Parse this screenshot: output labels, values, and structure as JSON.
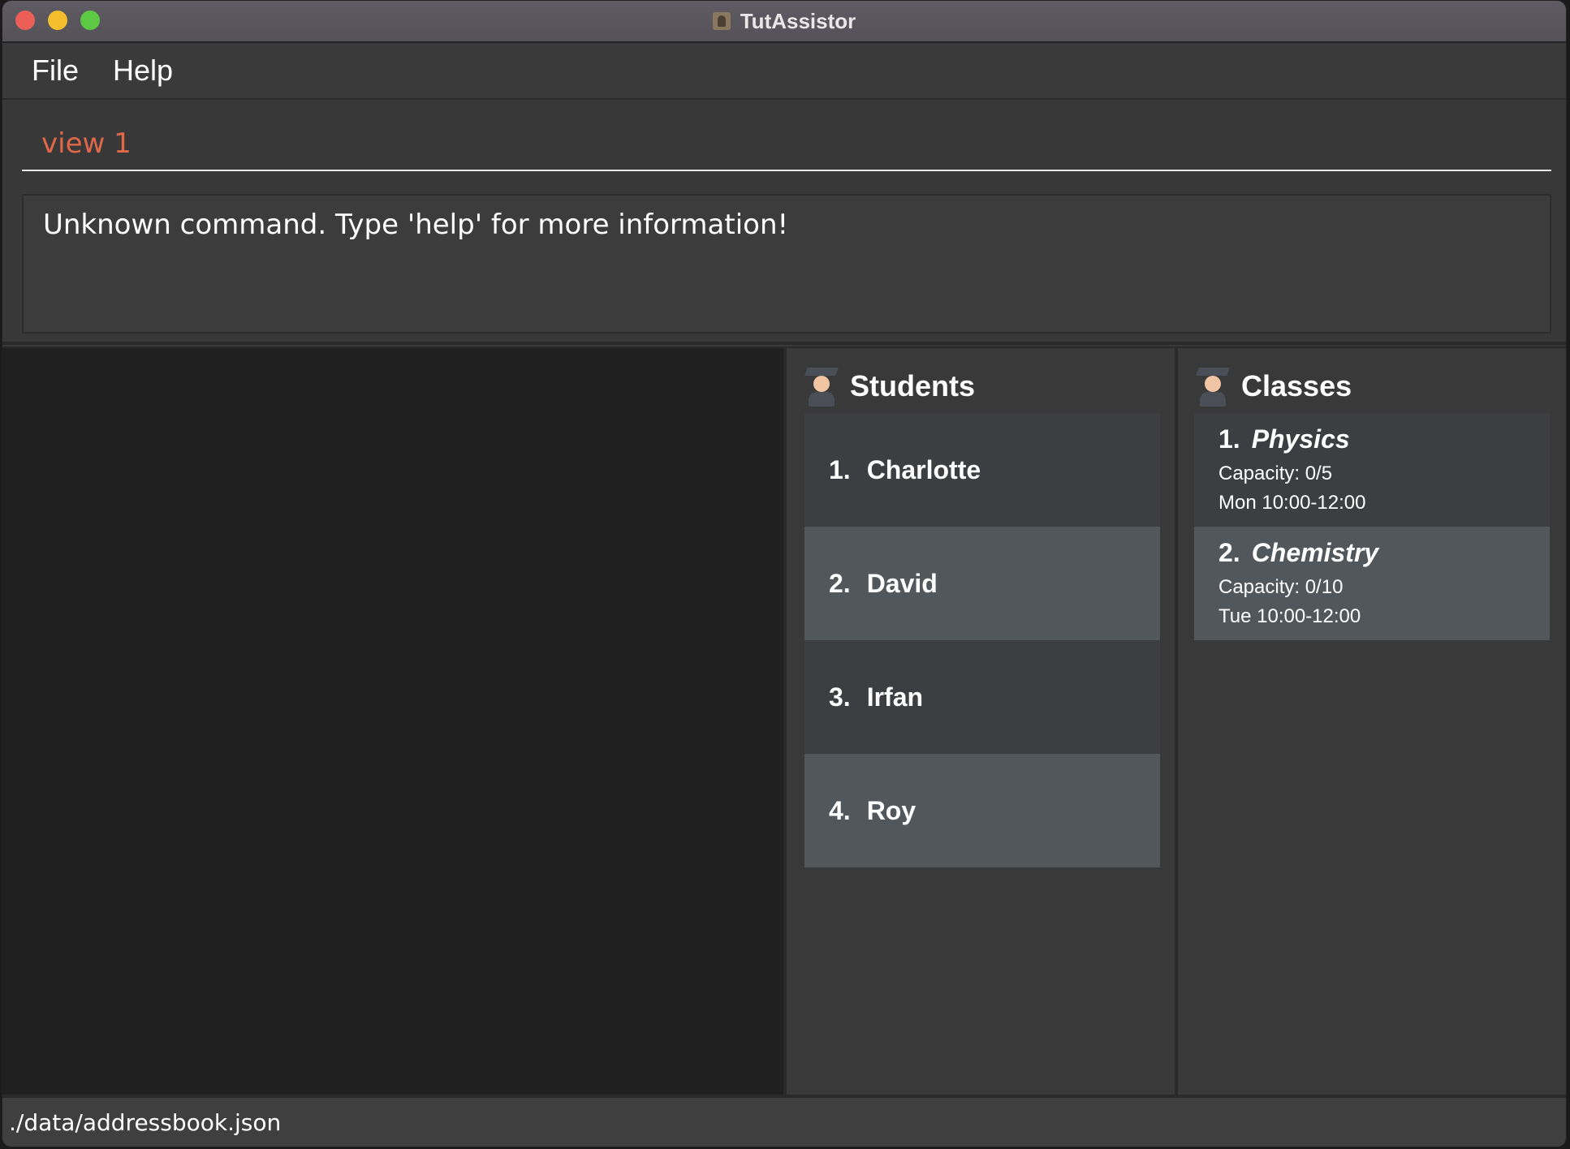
{
  "window": {
    "title": "TutAssistor"
  },
  "menu": {
    "file": "File",
    "help": "Help"
  },
  "command": {
    "value": "view 1"
  },
  "result": {
    "message": "Unknown command. Type 'help' for more information!"
  },
  "students": {
    "title": "Students",
    "items": [
      {
        "index": "1.",
        "name": "Charlotte"
      },
      {
        "index": "2.",
        "name": "David"
      },
      {
        "index": "3.",
        "name": "Irfan"
      },
      {
        "index": "4.",
        "name": "Roy"
      }
    ]
  },
  "classes": {
    "title": "Classes",
    "items": [
      {
        "index": "1.",
        "name": "Physics",
        "capacity": "Capacity: 0/5",
        "time": "Mon 10:00-12:00"
      },
      {
        "index": "2.",
        "name": "Chemistry",
        "capacity": "Capacity: 0/10",
        "time": "Tue 10:00-12:00"
      }
    ]
  },
  "status": {
    "path": "./data/addressbook.json"
  },
  "colors": {
    "command_text": "#e0684a",
    "row_dark": "#3c3e41",
    "row_light": "#51575a"
  }
}
